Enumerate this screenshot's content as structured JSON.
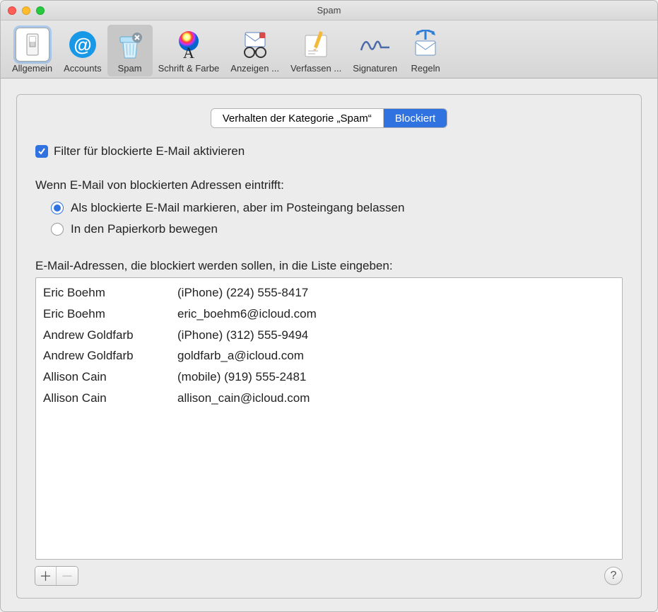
{
  "window": {
    "title": "Spam"
  },
  "toolbar": {
    "items": [
      {
        "label": "Allgemein"
      },
      {
        "label": "Accounts"
      },
      {
        "label": "Spam"
      },
      {
        "label": "Schrift & Farbe"
      },
      {
        "label": "Anzeigen ..."
      },
      {
        "label": "Verfassen ..."
      },
      {
        "label": "Signaturen"
      },
      {
        "label": "Regeln"
      }
    ]
  },
  "segmented": {
    "tab0": "Verhalten der Kategorie „Spam“",
    "tab1": "Blockiert"
  },
  "checkbox_label": "Filter für blockierte E-Mail aktivieren",
  "section_heading": "Wenn E-Mail von blockierten Adressen eintrifft:",
  "radio0": "Als blockierte E-Mail markieren, aber im Posteingang belassen",
  "radio1": "In den Papierkorb bewegen",
  "list_heading": "E-Mail-Adressen, die blockiert werden sollen, in die Liste eingeben:",
  "blocked": [
    {
      "name": "Eric Boehm",
      "contact": "(iPhone) (224) 555-8417"
    },
    {
      "name": "Eric Boehm",
      "contact": "eric_boehm6@icloud.com"
    },
    {
      "name": "Andrew Goldfarb",
      "contact": "(iPhone) (312) 555-9494"
    },
    {
      "name": "Andrew Goldfarb",
      "contact": "goldfarb_a@icloud.com"
    },
    {
      "name": "Allison Cain",
      "contact": "(mobile) (919) 555-2481"
    },
    {
      "name": "Allison Cain",
      "contact": "allison_cain@icloud.com"
    }
  ],
  "help_tooltip": "?"
}
